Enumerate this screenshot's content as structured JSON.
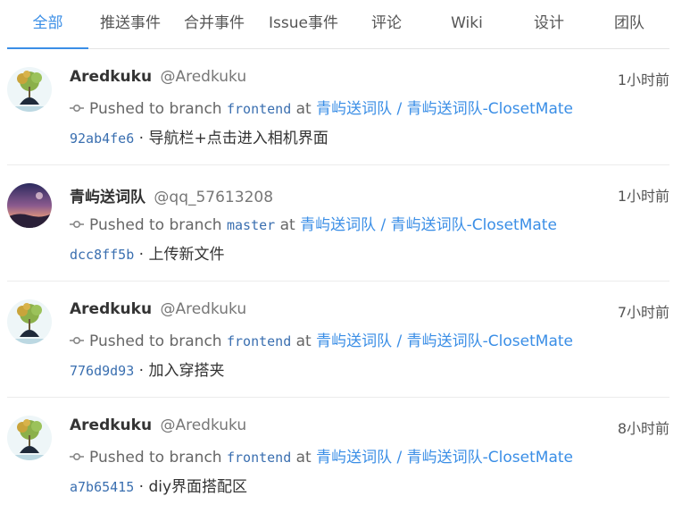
{
  "tabs": [
    {
      "label": "全部",
      "active": true
    },
    {
      "label": "推送事件"
    },
    {
      "label": "合并事件"
    },
    {
      "label": "Issue事件"
    },
    {
      "label": "评论"
    },
    {
      "label": "Wiki"
    },
    {
      "label": "设计"
    },
    {
      "label": "团队"
    }
  ],
  "event_words": {
    "pushed_to_branch": "Pushed to branch",
    "at": "at",
    "separator": " · "
  },
  "events": [
    {
      "author": "Aredkuku",
      "handle": "@Aredkuku",
      "time": "1小时前",
      "branch": "frontend",
      "repo": "青屿送词队 / 青屿送词队-ClosetMate",
      "sha": "92ab4fe6",
      "message": "导航栏+点击进入相机界面",
      "avatar": "plant-avatar"
    },
    {
      "author": "青屿送词队",
      "handle": "@qq_57613208",
      "time": "1小时前",
      "branch": "master",
      "repo": "青屿送词队 / 青屿送词队-ClosetMate",
      "sha": "dcc8ff5b",
      "message": "上传新文件",
      "avatar": "sunset-avatar"
    },
    {
      "author": "Aredkuku",
      "handle": "@Aredkuku",
      "time": "7小时前",
      "branch": "frontend",
      "repo": "青屿送词队 / 青屿送词队-ClosetMate",
      "sha": "776d9d93",
      "message": "加入穿搭夹",
      "avatar": "plant-avatar"
    },
    {
      "author": "Aredkuku",
      "handle": "@Aredkuku",
      "time": "8小时前",
      "branch": "frontend",
      "repo": "青屿送词队 / 青屿送词队-ClosetMate",
      "sha": "a7b65415",
      "message": "diy界面搭配区",
      "avatar": "plant-avatar"
    }
  ],
  "colors": {
    "accent": "#3a8ee6",
    "link_mono": "#3a6fb0"
  }
}
